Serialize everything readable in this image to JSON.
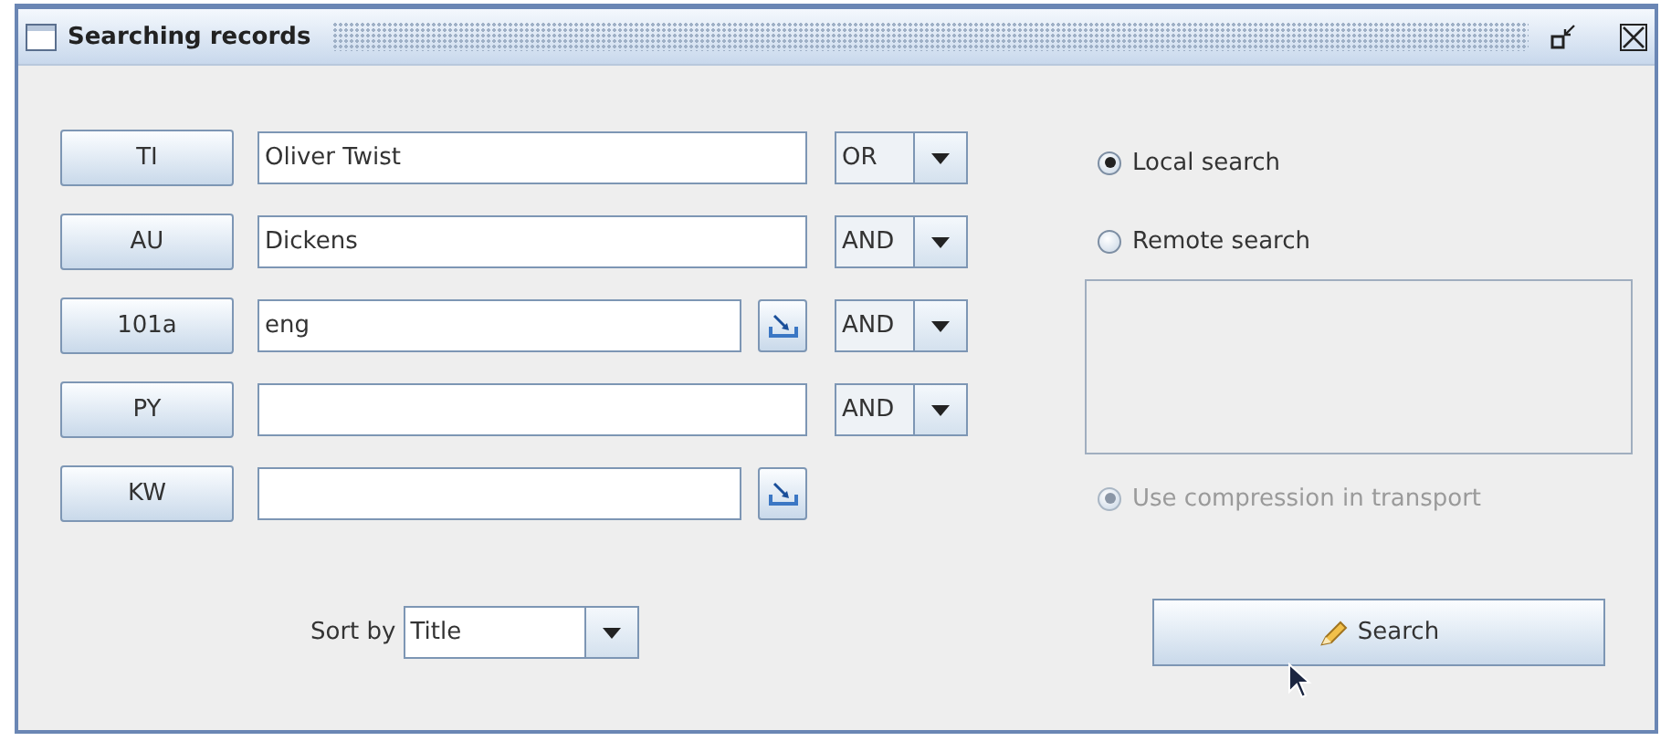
{
  "window": {
    "title": "Searching records"
  },
  "fields": [
    {
      "label": "TI",
      "value": "Oliver Twist",
      "picker": false,
      "operator": "OR"
    },
    {
      "label": "AU",
      "value": "Dickens",
      "picker": false,
      "operator": "AND"
    },
    {
      "label": "101a",
      "value": "eng",
      "picker": true,
      "operator": "AND"
    },
    {
      "label": "PY",
      "picker": false,
      "operator": "AND"
    },
    {
      "label": "KW",
      "picker": true
    }
  ],
  "search_mode": [
    {
      "label": "Local search",
      "selected": true,
      "disabled": false
    },
    {
      "label": "Remote search",
      "selected": false,
      "disabled": false
    }
  ],
  "compression": {
    "label": "Use compression in transport",
    "selected": true,
    "disabled": true
  },
  "sort": {
    "label": "Sort by",
    "value": "Title"
  },
  "search_button": {
    "label": "Search"
  }
}
